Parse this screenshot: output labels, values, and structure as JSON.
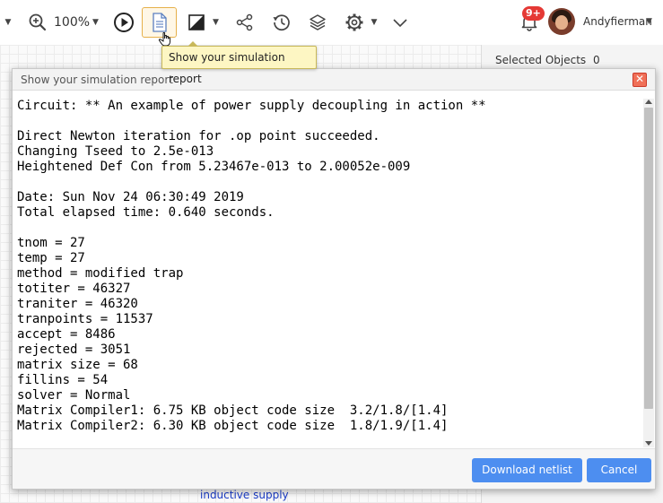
{
  "toolbar": {
    "zoom_label": "100%",
    "notification_count": "9+",
    "username": "Andyfierman",
    "tooltip": "Show your simulation report",
    "icons": [
      "caret-down-icon",
      "zoom-in-icon",
      "play-icon",
      "report-icon",
      "contrast-icon",
      "share-icon",
      "history-icon",
      "layers-icon",
      "gear-icon",
      "chevron-down-icon",
      "bell-icon"
    ]
  },
  "right_panel": {
    "selected_label": "Selected Objects",
    "selected_count": "0"
  },
  "background": {
    "link_text": "inductive supply"
  },
  "dialog": {
    "title": "Show your simulation report",
    "report_lines": [
      "Circuit: ** An example of power supply decoupling in action **",
      "",
      "Direct Newton iteration for .op point succeeded.",
      "Changing Tseed to 2.5e-013",
      "Heightened Def Con from 5.23467e-013 to 2.00052e-009",
      "",
      "Date: Sun Nov 24 06:30:49 2019",
      "Total elapsed time: 0.640 seconds.",
      "",
      "tnom = 27",
      "temp = 27",
      "method = modified trap",
      "totiter = 46327",
      "traniter = 46320",
      "tranpoints = 11537",
      "accept = 8486",
      "rejected = 3051",
      "matrix size = 68",
      "fillins = 54",
      "solver = Normal",
      "Matrix Compiler1: 6.75 KB object code size  3.2/1.8/[1.4]",
      "Matrix Compiler2: 6.30 KB object code size  1.8/1.9/[1.4]"
    ],
    "download_label": "Download netlist",
    "cancel_label": "Cancel",
    "colors": {
      "primary_button": "#4d8ef0",
      "close_button": "#f07058"
    }
  }
}
